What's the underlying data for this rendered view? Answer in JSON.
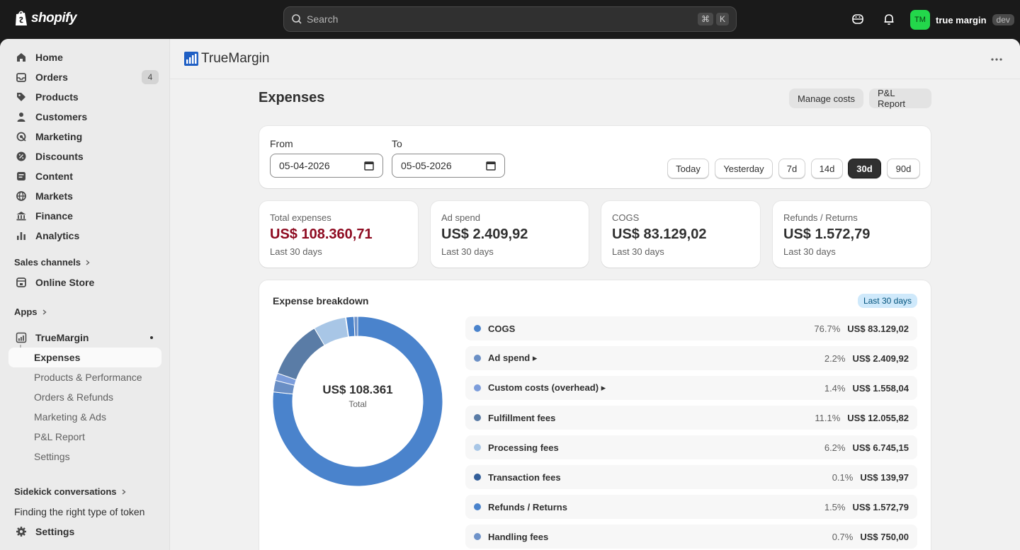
{
  "topbar": {
    "brand": "shopify",
    "search_placeholder": "Search",
    "shortcut_keys": [
      "⌘",
      "K"
    ],
    "account_initials": "TM",
    "account_name": "true margin",
    "account_badge": "dev"
  },
  "sidebar": {
    "items": [
      {
        "label": "Home",
        "icon": "home-icon"
      },
      {
        "label": "Orders",
        "icon": "orders-icon",
        "badge": "4"
      },
      {
        "label": "Products",
        "icon": "tag-icon"
      },
      {
        "label": "Customers",
        "icon": "person-icon"
      },
      {
        "label": "Marketing",
        "icon": "target-icon"
      },
      {
        "label": "Discounts",
        "icon": "discount-icon"
      },
      {
        "label": "Content",
        "icon": "content-icon"
      },
      {
        "label": "Markets",
        "icon": "globe-icon"
      },
      {
        "label": "Finance",
        "icon": "bank-icon"
      },
      {
        "label": "Analytics",
        "icon": "bar-chart-icon"
      }
    ],
    "sales_channels_label": "Sales channels",
    "online_store_label": "Online Store",
    "apps_label": "Apps",
    "app_label": "TrueMargin",
    "app_sub_items": [
      "Expenses",
      "Products & Performance",
      "Orders & Refunds",
      "Marketing & Ads",
      "P&L Report",
      "Settings"
    ],
    "sidekick_label": "Sidekick conversations",
    "sidekick_item": "Finding the right type of token",
    "settings_label": "Settings"
  },
  "app_header": {
    "title": "TrueMargin"
  },
  "page": {
    "title": "Expenses",
    "manage_costs_label": "Manage costs",
    "pl_report_label": "P&L Report"
  },
  "date_filter": {
    "from_label": "From",
    "from_value": "05-04-2026",
    "to_label": "To",
    "to_value": "05-05-2026",
    "ranges": [
      "Today",
      "Yesterday",
      "7d",
      "14d",
      "30d",
      "90d"
    ],
    "active_range": "30d"
  },
  "stats": [
    {
      "label": "Total expenses",
      "value": "US$ 108.360,71",
      "sub": "Last 30 days"
    },
    {
      "label": "Ad spend",
      "value": "US$ 2.409,92",
      "sub": "Last 30 days"
    },
    {
      "label": "COGS",
      "value": "US$ 83.129,02",
      "sub": "Last 30 days"
    },
    {
      "label": "Refunds / Returns",
      "value": "US$ 1.572,79",
      "sub": "Last 30 days"
    }
  ],
  "breakdown": {
    "title": "Expense breakdown",
    "period": "Last 30 days",
    "total_label": "US$ 108.361",
    "total_sub": "Total",
    "rows": [
      {
        "label": "COGS",
        "pct": "76.7%",
        "amount": "US$ 83.129,02",
        "color": "#4a83cc"
      },
      {
        "label": "Ad spend ▸",
        "pct": "2.2%",
        "amount": "US$ 2.409,92",
        "color": "#6a8fc5"
      },
      {
        "label": "Custom costs (overhead) ▸",
        "pct": "1.4%",
        "amount": "US$ 1.558,04",
        "color": "#7c9ddb"
      },
      {
        "label": "Fulfillment fees",
        "pct": "11.1%",
        "amount": "US$ 12.055,82",
        "color": "#5a7ca6"
      },
      {
        "label": "Processing fees",
        "pct": "6.2%",
        "amount": "US$ 6.745,15",
        "color": "#a8c6e6"
      },
      {
        "label": "Transaction fees",
        "pct": "0.1%",
        "amount": "US$ 139,97",
        "color": "#335e99"
      },
      {
        "label": "Refunds / Returns",
        "pct": "1.5%",
        "amount": "US$ 1.572,79",
        "color": "#4a83cc"
      },
      {
        "label": "Handling fees",
        "pct": "0.7%",
        "amount": "US$ 750,00",
        "color": "#6f93c9"
      }
    ]
  }
}
